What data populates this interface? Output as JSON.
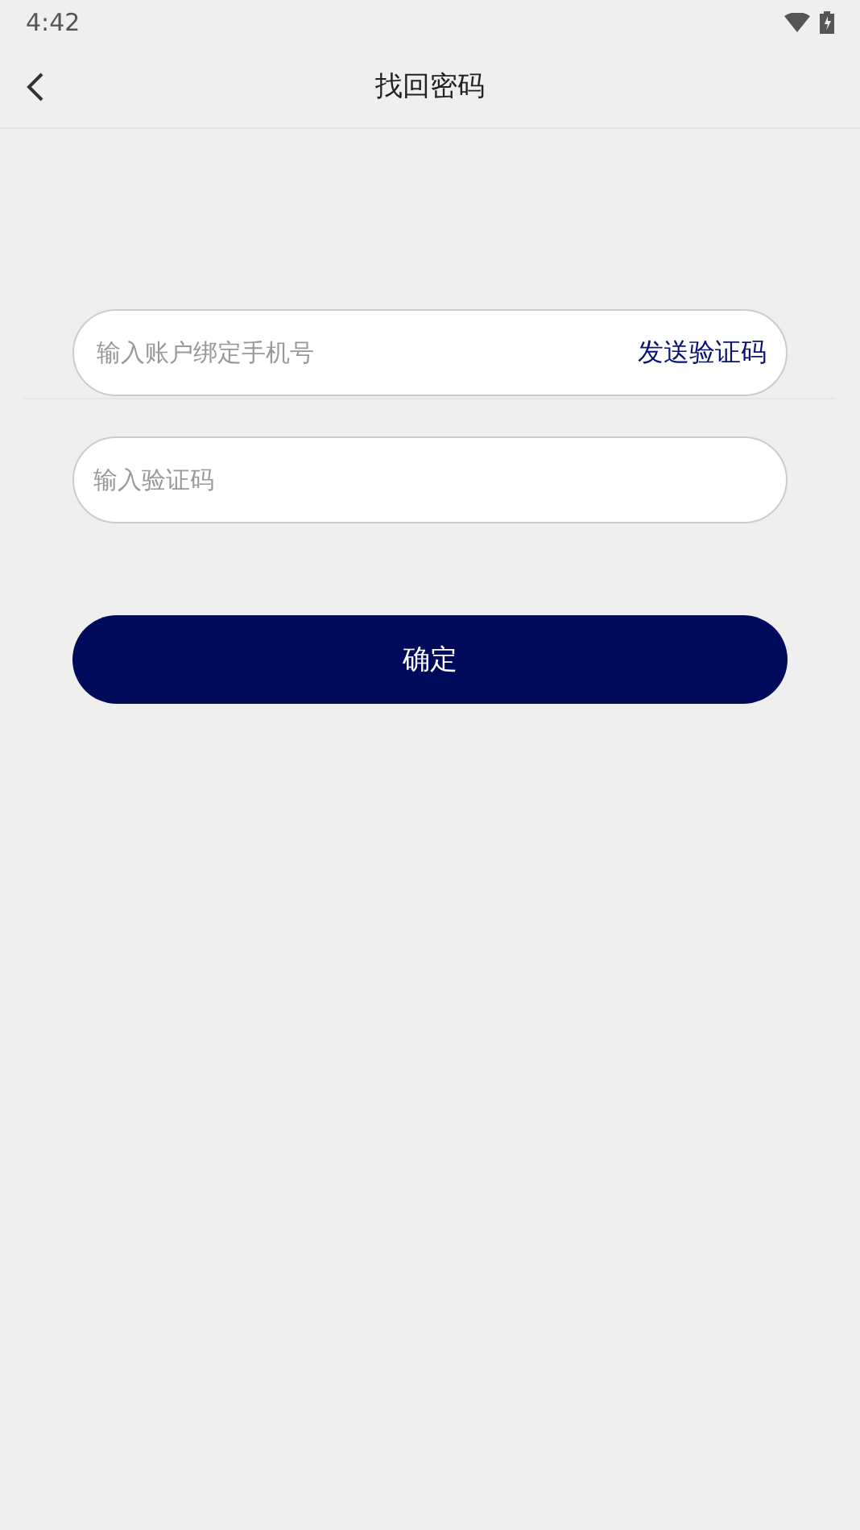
{
  "status_bar": {
    "time": "4:42"
  },
  "header": {
    "title": "找回密码"
  },
  "phone_field": {
    "placeholder": "输入账户绑定手机号",
    "action": "发送验证码"
  },
  "code_field": {
    "placeholder": "输入验证码"
  },
  "confirm_button": {
    "label": "确定"
  }
}
